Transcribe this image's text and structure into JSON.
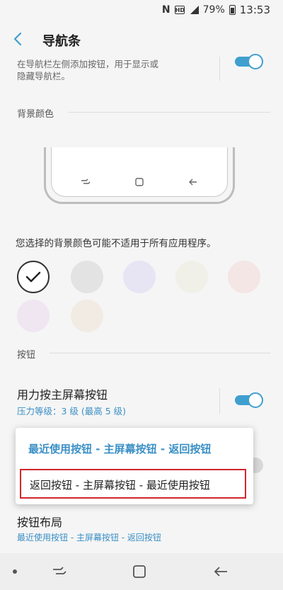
{
  "status_bar": {
    "battery": "79%",
    "time": "13:53",
    "hd_label": "HD"
  },
  "header": {
    "title": "导航条"
  },
  "top_row": {
    "desc_line1": "在导航栏左侧添加按钮，用于显示或",
    "desc_line2": "隐藏导航栏。"
  },
  "background_color": {
    "section_title": "背景颜色",
    "note": "您选择的背景颜色可能不适用于所有应用程序。",
    "swatches": [
      "#ffffff",
      "#e3e3e3",
      "#e7e5f3",
      "#f1f0e8",
      "#f3e6e5",
      "#efe6f1",
      "#f2ebe3"
    ]
  },
  "buttons_section": {
    "section_title": "按钮",
    "press_home": {
      "title": "用力按主屏幕按钮",
      "subtitle": "压力等级：3 级 (最高 5 级)"
    },
    "layout": {
      "title": "按钮布局",
      "subtitle": "最近使用按钮 - 主屏幕按钮 - 返回按钮"
    }
  },
  "menu": {
    "option1": "最近使用按钮 - 主屏幕按钮 - 返回按钮",
    "option2": "返回按钮 - 主屏幕按钮 - 最近使用按钮"
  },
  "colors": {
    "accent": "#3f9fcf",
    "highlight": "#d0262d",
    "menu_text": "#3a8fc6"
  }
}
